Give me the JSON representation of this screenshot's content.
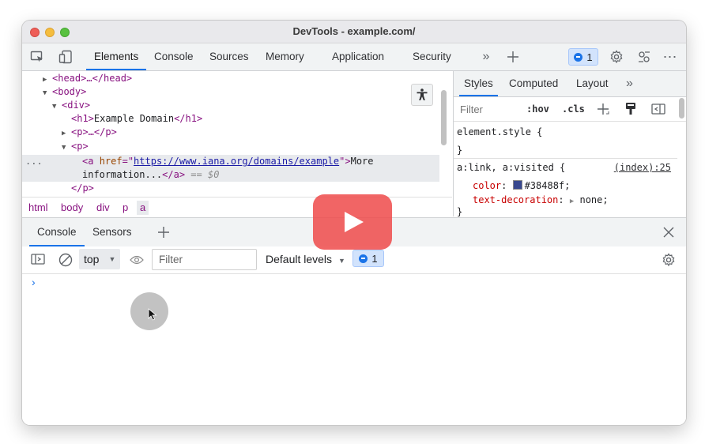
{
  "window": {
    "title": "DevTools - example.com/"
  },
  "main_tabs": [
    "Elements",
    "Console",
    "Sources",
    "Memory",
    "Application",
    "Security"
  ],
  "issues_count": "1",
  "dom": {
    "head_line": "<head>…</head>",
    "body_open": "<body>",
    "div_open": "<div>",
    "h1_open": "<h1>",
    "h1_text": "Example Domain",
    "h1_close": "</h1>",
    "p_collapsed": "<p>…</p>",
    "p_open": "<p>",
    "a_open": "<a",
    "a_attr": "href",
    "a_href": "https://www.iana.org/domains/example",
    "a_text1": "More",
    "a_text2": "information...",
    "a_close": "</a>",
    "selected_marker": "== $0",
    "p_close": "</p>",
    "ellipsis": "..."
  },
  "breadcrumbs": [
    "html",
    "body",
    "div",
    "p",
    "a"
  ],
  "styles": {
    "tabs": [
      "Styles",
      "Computed",
      "Layout"
    ],
    "filter_placeholder": "Filter",
    "hov": ":hov",
    "cls": ".cls",
    "element_style": "element.style {",
    "close_brace": "}",
    "rule_selector": "a:link, a:visited {",
    "rule_source": "(index):25",
    "color_prop": "color",
    "color_value": "#38488f;",
    "color_hex": "#38488f",
    "deco_prop": "text-decoration",
    "deco_value": "none;"
  },
  "drawer": {
    "tabs": [
      "Console",
      "Sensors"
    ],
    "context": "top",
    "filter_placeholder": "Filter",
    "levels": "Default levels",
    "issues_count": "1",
    "prompt": "›"
  }
}
